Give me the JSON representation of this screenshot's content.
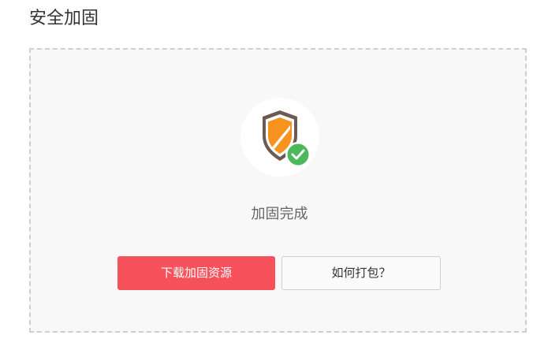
{
  "page": {
    "title": "安全加固"
  },
  "status": {
    "icon": "shield-check-icon",
    "text": "加固完成"
  },
  "actions": {
    "download_label": "下载加固资源",
    "help_label": "如何打包？"
  },
  "colors": {
    "accent": "#f7515c",
    "shield_orange": "#f7921e",
    "check_green": "#4cb85c",
    "shield_frame": "#6b5b52"
  }
}
